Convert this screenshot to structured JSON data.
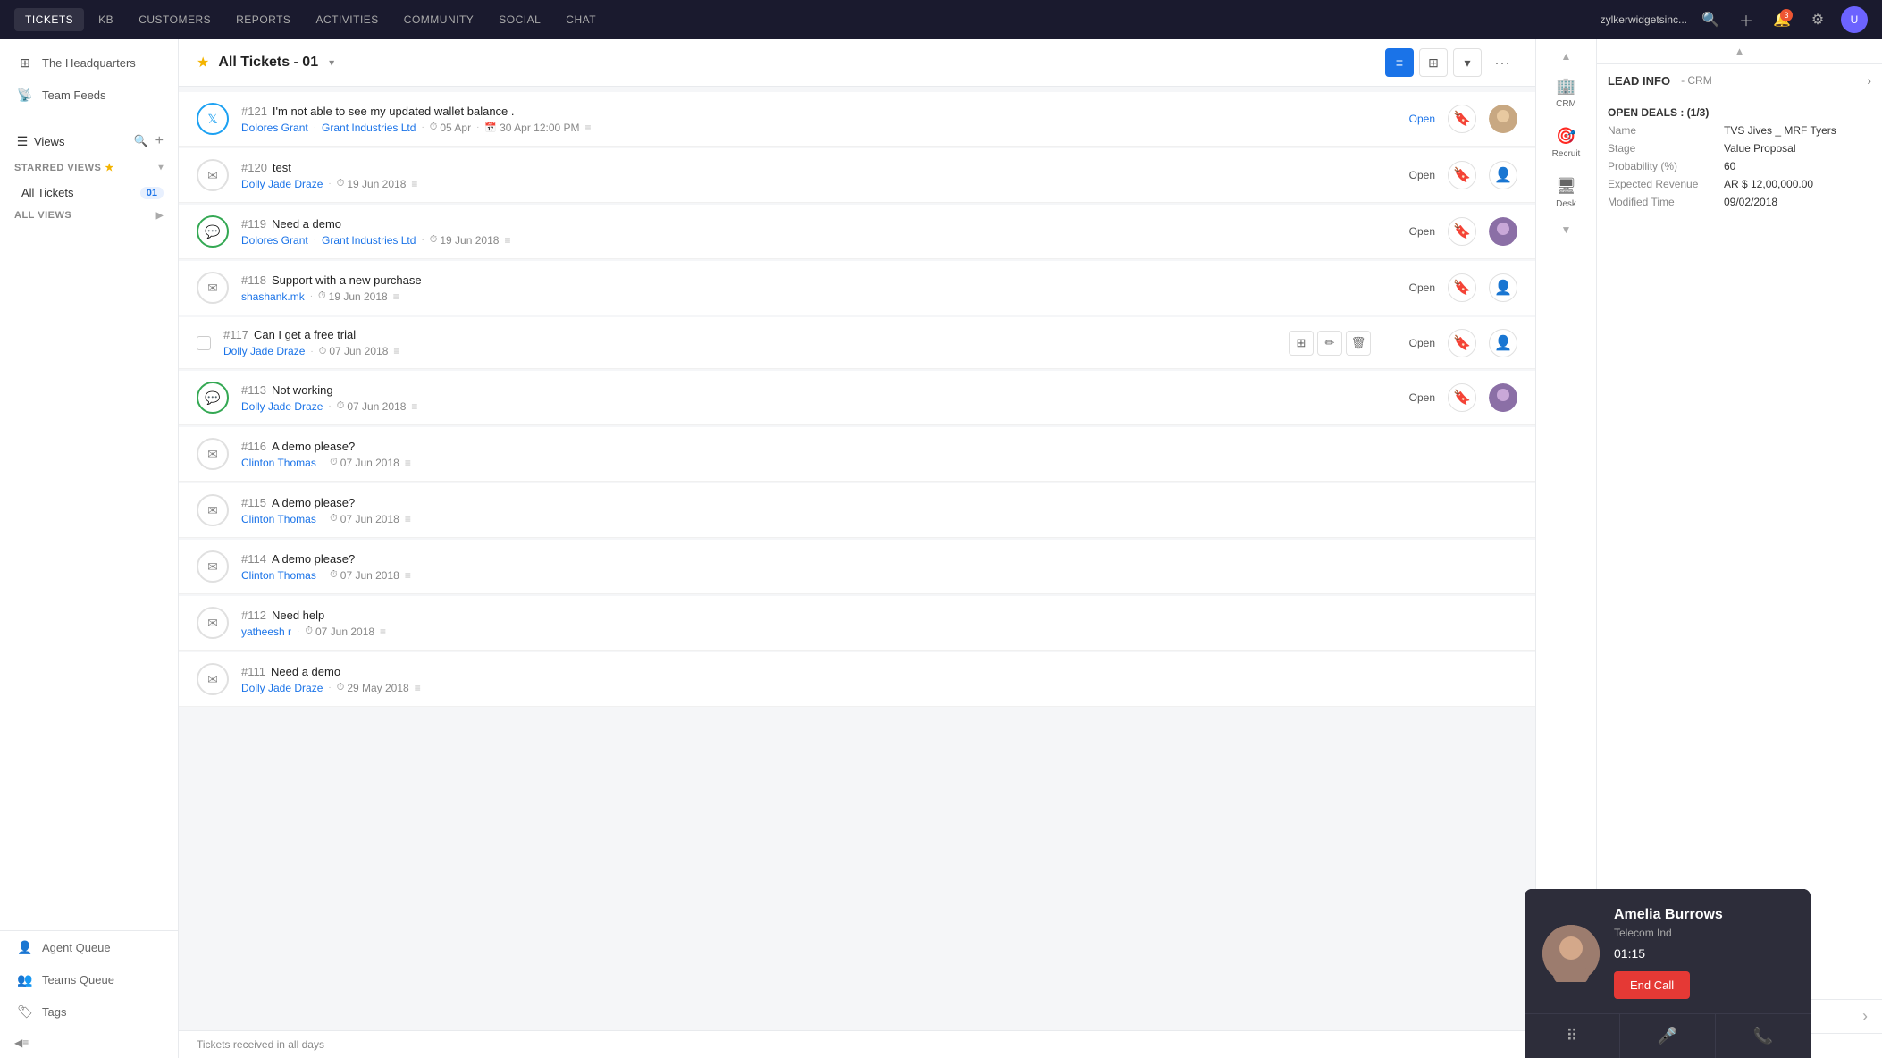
{
  "topNav": {
    "items": [
      {
        "id": "tickets",
        "label": "TICKETS",
        "active": true
      },
      {
        "id": "kb",
        "label": "KB",
        "active": false
      },
      {
        "id": "customers",
        "label": "CUSTOMERS",
        "active": false
      },
      {
        "id": "reports",
        "label": "REPORTS",
        "active": false
      },
      {
        "id": "activities",
        "label": "ACTIVITIES",
        "active": false
      },
      {
        "id": "community",
        "label": "COMMUNITY",
        "active": false
      },
      {
        "id": "social",
        "label": "SOCIAL",
        "active": false
      },
      {
        "id": "chat",
        "label": "CHAT",
        "active": false
      }
    ],
    "domain": "zylkerwidgetsinc...",
    "notifCount": "3"
  },
  "sidebar": {
    "headquarters": "The Headquarters",
    "teamFeeds": "Team Feeds",
    "views": "Views",
    "starredViews": "STARRED VIEWS",
    "allViews": "ALL VIEWS",
    "allTickets": "All Tickets",
    "allTicketsCount": "01",
    "agentQueue": "Agent Queue",
    "teamsQueue": "Teams Queue",
    "tags": "Tags"
  },
  "ticketsHeader": {
    "title": "All Tickets - 01",
    "star": "★"
  },
  "tickets": [
    {
      "id": "121",
      "subject": "I'm not able to see my updated wallet balance .",
      "contact": "Dolores Grant",
      "company": "Grant Industries Ltd",
      "date": "05 Apr",
      "date2": "30 Apr 12:00 PM",
      "channel": "twitter",
      "status": "Open",
      "hasAvatar": true
    },
    {
      "id": "120",
      "subject": "test",
      "contact": "Dolly Jade Draze",
      "company": "",
      "date": "19 Jun 2018",
      "date2": "",
      "channel": "email",
      "status": "Open",
      "hasAvatar": false
    },
    {
      "id": "119",
      "subject": "Need a demo",
      "contact": "Dolores Grant",
      "company": "Grant Industries Ltd",
      "date": "19 Jun 2018",
      "date2": "",
      "channel": "chat",
      "status": "Open",
      "hasAvatar": true
    },
    {
      "id": "118",
      "subject": "Support with a new purchase",
      "contact": "shashank.mk",
      "company": "",
      "date": "19 Jun 2018",
      "date2": "",
      "channel": "email",
      "status": "Open",
      "hasAvatar": false
    },
    {
      "id": "117",
      "subject": "Can I get a free trial",
      "contact": "Dolly Jade Draze",
      "company": "",
      "date": "07 Jun 2018",
      "date2": "",
      "channel": "email",
      "status": "Open",
      "hasAvatar": false,
      "showActions": true
    },
    {
      "id": "113",
      "subject": "Not working",
      "contact": "Dolly Jade Draze",
      "company": "",
      "date": "07 Jun 2018",
      "date2": "",
      "channel": "chat",
      "status": "Open",
      "hasAvatar": true
    },
    {
      "id": "116",
      "subject": "A demo please?",
      "contact": "Clinton Thomas",
      "company": "",
      "date": "07 Jun 2018",
      "date2": "",
      "channel": "email",
      "status": "",
      "hasAvatar": false
    },
    {
      "id": "115",
      "subject": "A demo please?",
      "contact": "Clinton Thomas",
      "company": "",
      "date": "07 Jun 2018",
      "date2": "",
      "channel": "email",
      "status": "",
      "hasAvatar": false
    },
    {
      "id": "114",
      "subject": "A demo please?",
      "contact": "Clinton Thomas",
      "company": "",
      "date": "07 Jun 2018",
      "date2": "",
      "channel": "email",
      "status": "",
      "hasAvatar": false
    },
    {
      "id": "112",
      "subject": "Need help",
      "contact": "yatheesh r",
      "company": "",
      "date": "07 Jun 2018",
      "date2": "",
      "channel": "email",
      "status": "",
      "hasAvatar": false
    },
    {
      "id": "111",
      "subject": "Need a demo",
      "contact": "Dolly Jade Draze",
      "company": "",
      "date": "29 May 2018",
      "date2": "",
      "channel": "email",
      "status": "",
      "hasAvatar": false
    }
  ],
  "footer": {
    "text": "Tickets received in all days"
  },
  "callPanel": {
    "name": "Amelia Burrows",
    "company": "Telecom Ind",
    "timer": "01:15",
    "endCallLabel": "End Call",
    "controls": [
      "keypad",
      "mic",
      "phone"
    ]
  },
  "rightPanel": {
    "leadInfo": "LEAD INFO",
    "crmTag": "- CRM",
    "openDeals": "OPEN DEALS : (1/3)",
    "deal": {
      "name": "TVS Jives _ MRF Tyers",
      "stage": "Value Proposal",
      "probability": "60",
      "expectedRevenue": "AR $ 12,00,000.00",
      "modifiedTime": "09/02/2018"
    },
    "navItems": [
      {
        "id": "crm",
        "label": "CRM"
      },
      {
        "id": "recruit",
        "label": "Recruit"
      },
      {
        "id": "desk",
        "label": "Desk"
      }
    ]
  }
}
